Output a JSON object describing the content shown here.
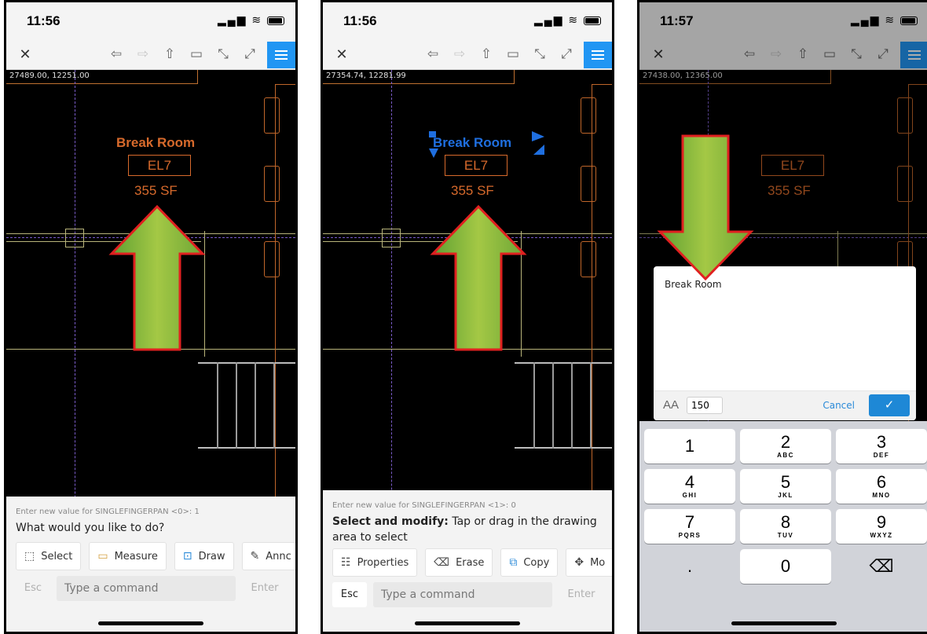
{
  "panels": [
    {
      "time": "11:56",
      "coords": "27489.00, 12251.00",
      "room": {
        "name": "Break Room",
        "code": "EL7",
        "area": "355 SF"
      },
      "prompt_small": "Enter new value for SINGLEFINGERPAN <0>: 1",
      "prompt_main": "What would you like to do?",
      "actions": [
        {
          "icon": "select-icon",
          "label": "Select"
        },
        {
          "icon": "ruler-icon",
          "label": "Measure"
        },
        {
          "icon": "draw-icon",
          "label": "Draw"
        },
        {
          "icon": "annotate-icon",
          "label": "Annc"
        }
      ],
      "esc": "Esc",
      "command_placeholder": "Type a command",
      "enter": "Enter"
    },
    {
      "time": "11:56",
      "coords": "27354.74, 12281.99",
      "room": {
        "name": "Break Room",
        "code": "EL7",
        "area": "355 SF"
      },
      "prompt_small": "Enter new value for SINGLEFINGERPAN <1>: 0",
      "prompt_bold": "Select and modify:",
      "prompt_rest": " Tap or drag in the drawing area to select",
      "actions": [
        {
          "icon": "properties-icon",
          "label": "Properties"
        },
        {
          "icon": "erase-icon",
          "label": "Erase"
        },
        {
          "icon": "copy-icon",
          "label": "Copy"
        },
        {
          "icon": "move-icon",
          "label": "Mo"
        }
      ],
      "esc": "Esc",
      "command_placeholder": "Type a command",
      "enter": "Enter"
    },
    {
      "time": "11:57",
      "coords": "27438.00, 12365.00",
      "room": {
        "code": "EL7",
        "area": "355 SF"
      },
      "dialog": {
        "text": "Break Room",
        "font_size_label": "AA",
        "font_size_value": "150",
        "cancel": "Cancel",
        "confirm": "✓"
      },
      "keypad": [
        {
          "digit": "1",
          "letters": ""
        },
        {
          "digit": "2",
          "letters": "ABC"
        },
        {
          "digit": "3",
          "letters": "DEF"
        },
        {
          "digit": "4",
          "letters": "GHI"
        },
        {
          "digit": "5",
          "letters": "JKL"
        },
        {
          "digit": "6",
          "letters": "MNO"
        },
        {
          "digit": "7",
          "letters": "PQRS"
        },
        {
          "digit": "8",
          "letters": "TUV"
        },
        {
          "digit": "9",
          "letters": "WXYZ"
        },
        {
          "digit": ".",
          "letters": ""
        },
        {
          "digit": "0",
          "letters": ""
        },
        {
          "digit": "⌫",
          "letters": ""
        }
      ]
    }
  ],
  "toolbar_icons": [
    "close-icon",
    "undo-icon",
    "redo-icon",
    "share-icon",
    "save-icon",
    "zoom-extents-icon",
    "fullscreen-icon",
    "menu-icon"
  ],
  "colors": {
    "accent": "#2196f3",
    "room_text": "#d76a2c",
    "arrow_green": "#8bbb3c",
    "arrow_border": "#e02020",
    "selection_blue": "#1f6fe0"
  }
}
